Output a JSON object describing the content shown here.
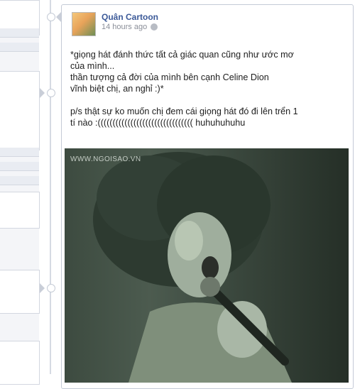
{
  "post": {
    "author": "Quân Cartoon",
    "time": "14 hours ago",
    "text_lines": [
      "*giọng hát đánh thức tất cả giác quan cũng như ước mơ",
      "của mình...",
      "thần tượng cả đời của mình bên cạnh Celine Dion",
      "vĩnh biệt chị, an nghỉ :)*"
    ],
    "ps_lines": [
      "p/s thật sự ko muốn chị đem cái giọng hát đó đi lên trển 1",
      "tí nào :(((((((((((((((((((((((((((((((( huhuhuhuhu"
    ]
  },
  "photo": {
    "watermark": "WWW.NGOISAO.VN"
  },
  "icons": {
    "privacy": "globe-icon",
    "avatar": "avatar"
  }
}
